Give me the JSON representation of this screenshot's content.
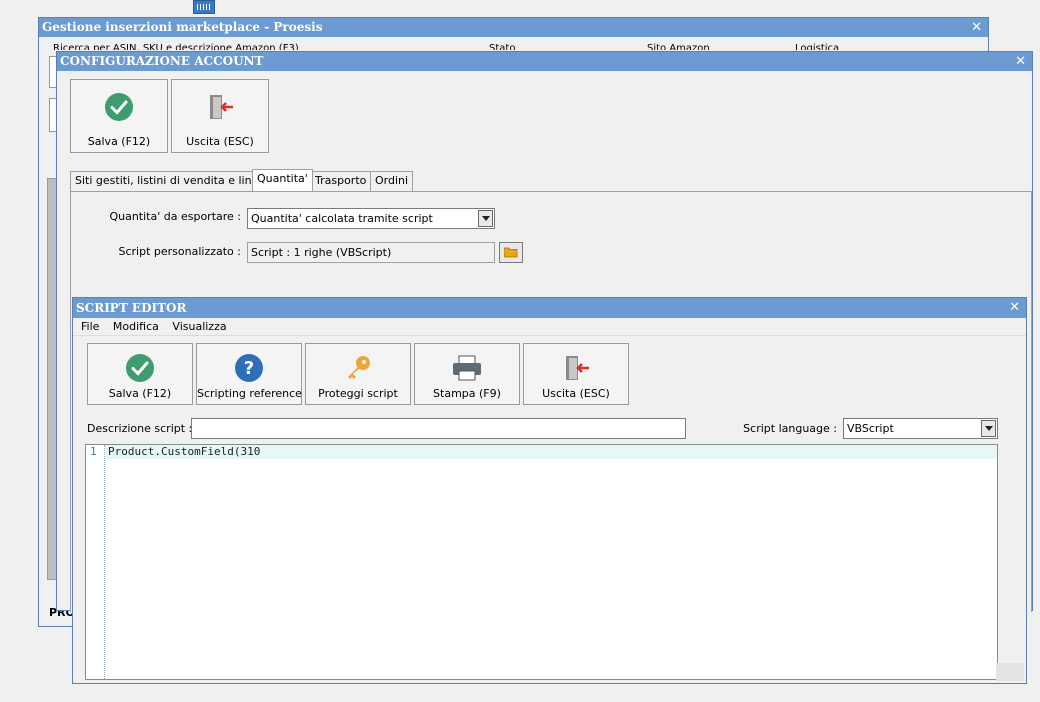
{
  "back_window": {
    "title": "Gestione inserzioni marketplace - Proesis",
    "search_label": "Ricerca per ASIN, SKU e descrizione Amazon (F3)",
    "stato_label": "Stato",
    "sito_label": "Sito Amazon",
    "logistica_label": "Logistica",
    "bottom_label": "PRO"
  },
  "config_window": {
    "title": "CONFIGURAZIONE ACCOUNT",
    "save_label": "Salva (F12)",
    "exit_label": "Uscita (ESC)",
    "tabs": [
      {
        "label": "Siti gestiti, listini di vendita e lingue"
      },
      {
        "label": "Quantita'"
      },
      {
        "label": "Trasporto"
      },
      {
        "label": "Ordini"
      }
    ],
    "qty_label": "Quantita' da esportare :",
    "qty_value": "Quantita' calcolata tramite script",
    "script_label": "Script personalizzato :",
    "script_value": "Script : 1 righe (VBScript)"
  },
  "script_editor": {
    "title": "SCRIPT EDITOR",
    "menu": [
      {
        "label": "File"
      },
      {
        "label": "Modifica"
      },
      {
        "label": "Visualizza"
      }
    ],
    "buttons": [
      {
        "label": "Salva (F12)"
      },
      {
        "label": "Scripting reference"
      },
      {
        "label": "Proteggi script"
      },
      {
        "label": "Stampa (F9)"
      },
      {
        "label": "Uscita (ESC)"
      }
    ],
    "desc_label": "Descrizione script :",
    "desc_value": "",
    "lang_label": "Script language :",
    "lang_value": "VBScript",
    "code_lines": [
      {
        "num": "1",
        "text": "Product.CustomField(310"
      }
    ]
  },
  "colors": {
    "titlebar": "#6b9bd1",
    "check": "#3f9c6e",
    "help": "#2f6fba",
    "exit_arrow": "#d9322b",
    "line_highlight": "#e6f7f7"
  }
}
